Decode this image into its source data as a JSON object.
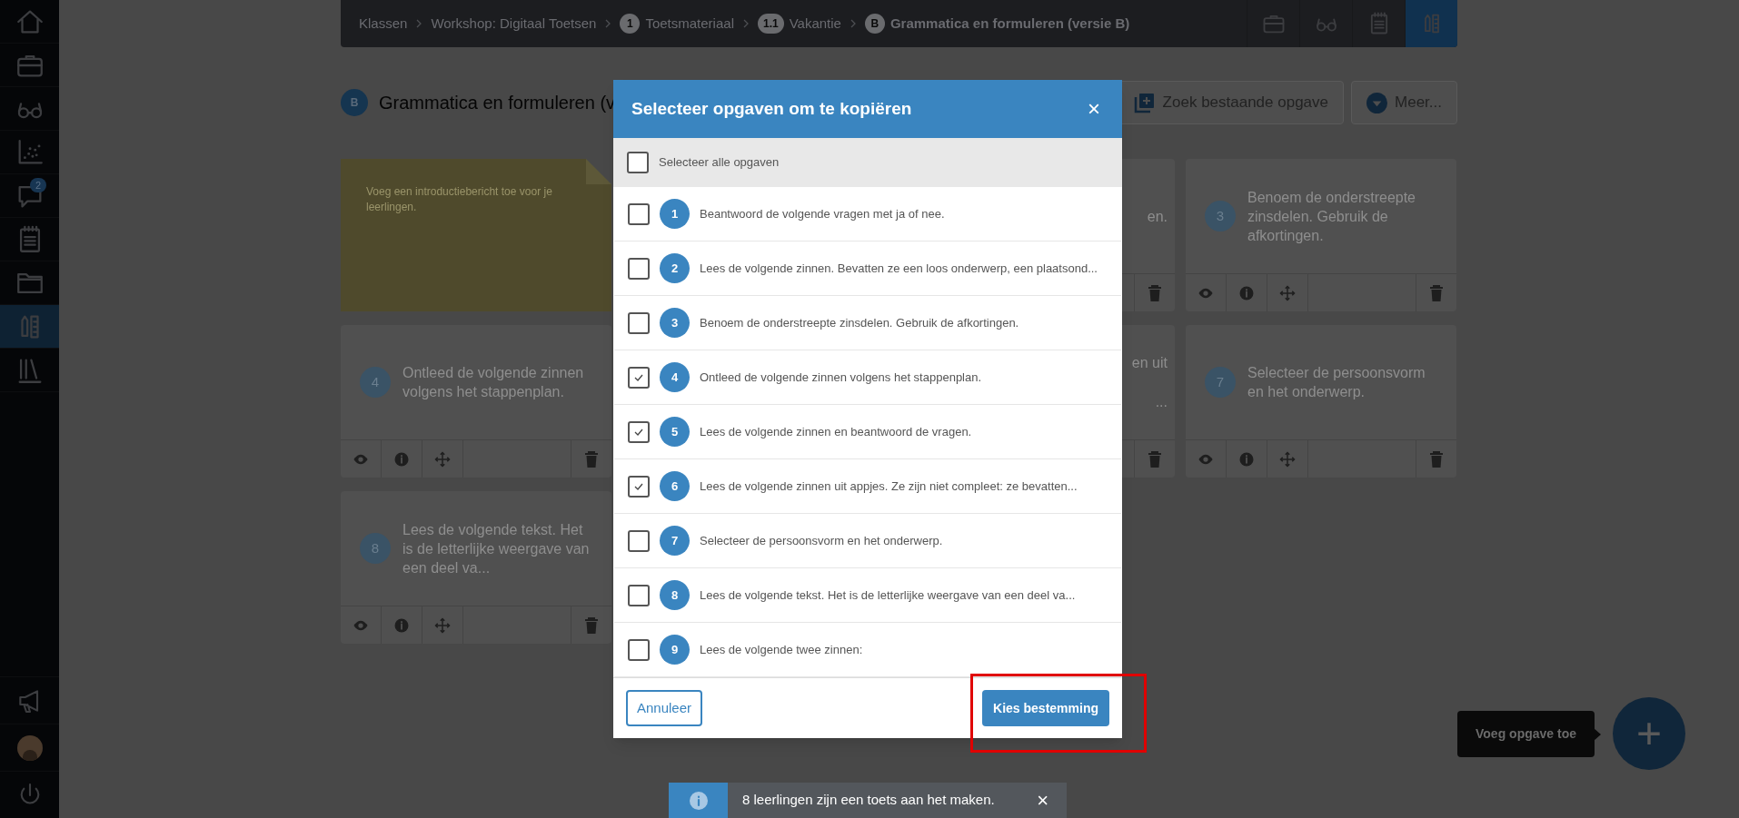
{
  "sidebar": {
    "top_items": [
      {
        "kind": "home",
        "selected": false
      },
      {
        "kind": "briefcase",
        "selected": false
      },
      {
        "kind": "glasses",
        "selected": false
      },
      {
        "kind": "chart",
        "selected": false
      },
      {
        "kind": "chat",
        "selected": false,
        "badge": "2"
      },
      {
        "kind": "notepad",
        "selected": false
      },
      {
        "kind": "folder",
        "selected": false
      },
      {
        "kind": "ruler",
        "selected": true
      },
      {
        "kind": "books",
        "selected": false
      }
    ],
    "bottom_items": [
      {
        "kind": "megaphone"
      },
      {
        "kind": "avatar"
      },
      {
        "kind": "power"
      }
    ]
  },
  "header": {
    "breadcrumb": [
      {
        "label": "Klassen"
      },
      {
        "label": "Workshop: Digitaal Toetsen"
      },
      {
        "badge": "1",
        "label": "Toetsmateriaal"
      },
      {
        "badge": "1.1",
        "label": "Vakantie"
      },
      {
        "badge": "B",
        "label": "Grammatica en formuleren (versie B)"
      }
    ],
    "tools": [
      {
        "kind": "briefcase",
        "selected": false
      },
      {
        "kind": "glasses",
        "selected": false
      },
      {
        "kind": "notepad",
        "selected": false
      },
      {
        "kind": "ruler",
        "selected": true
      }
    ]
  },
  "title": {
    "badge": "B",
    "text": "Grammatica en formuleren (v"
  },
  "actions": [
    {
      "kind": "add",
      "label": "Zoek bestaande opgave"
    },
    {
      "kind": "more",
      "label": "Meer..."
    }
  ],
  "cards": [
    {
      "kind": "note",
      "text": "Voeg een introductiebericht toe voor je leerlingen."
    },
    {
      "kind": "partial",
      "fragments": [
        "en."
      ]
    },
    {
      "kind": "task",
      "number": "3",
      "text": "Benoem de onderstreepte zinsdelen. Gebruik de afkortingen."
    },
    {
      "kind": "task",
      "number": "4",
      "text": "Ontleed de volgende zinnen volgens het stappenplan."
    },
    {
      "kind": "partial",
      "fragments": [
        "en uit",
        "..."
      ]
    },
    {
      "kind": "task",
      "number": "7",
      "text": "Selecteer de persoonsvorm en het onderwerp."
    },
    {
      "kind": "task",
      "number": "8",
      "text": "Lees de volgende tekst. Het is de letterlijke weergave van een deel va..."
    }
  ],
  "modal": {
    "title": "Selecteer opgaven om te kopiëren",
    "close": "×",
    "select_all": {
      "label": "Selecteer alle opgaven",
      "checked": false
    },
    "items": [
      {
        "number": "1",
        "text": "Beantwoord de volgende vragen met ja of nee.",
        "checked": false
      },
      {
        "number": "2",
        "text": "Lees de volgende zinnen. Bevatten ze een loos onderwerp, een plaatsond...",
        "checked": false
      },
      {
        "number": "3",
        "text": "Benoem de onderstreepte zinsdelen. Gebruik de afkortingen.",
        "checked": false
      },
      {
        "number": "4",
        "text": "Ontleed de volgende zinnen volgens het stappenplan.",
        "checked": true
      },
      {
        "number": "5",
        "text": "Lees de volgende zinnen en beantwoord de vragen.",
        "checked": true
      },
      {
        "number": "6",
        "text": "Lees de volgende zinnen uit appjes. Ze zijn niet compleet: ze bevatten...",
        "checked": true
      },
      {
        "number": "7",
        "text": "Selecteer de persoonsvorm en het onderwerp.",
        "checked": false
      },
      {
        "number": "8",
        "text": "Lees de volgende tekst. Het is de letterlijke weergave van een deel va...",
        "checked": false
      },
      {
        "number": "9",
        "text": "Lees de volgende twee zinnen:",
        "checked": false
      }
    ],
    "cancel": "Annuleer",
    "confirm": "Kies bestemming"
  },
  "tooltip": "Voeg opgave toe",
  "fab": "+",
  "toast": {
    "text": "8 leerlingen zijn een toets aan het maken.",
    "close": "×"
  }
}
